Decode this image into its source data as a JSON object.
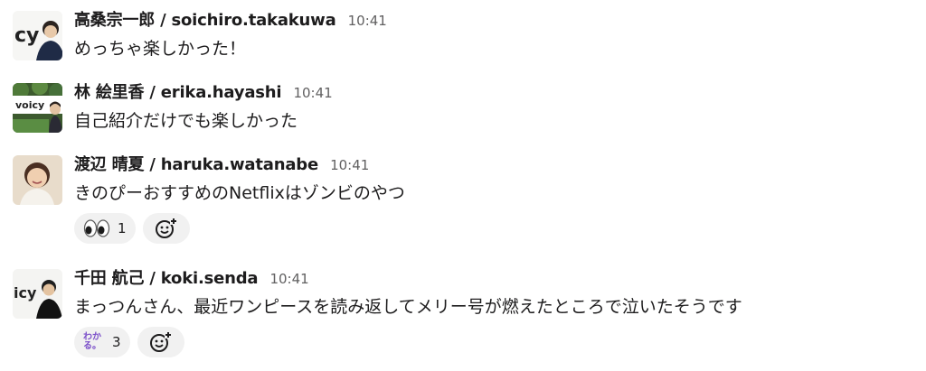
{
  "messages": [
    {
      "author": "高桑宗一郎 / soichiro.takakuwa",
      "time": "10:41",
      "text": "めっちゃ楽しかった！",
      "avatar_text": "cy",
      "reactions": []
    },
    {
      "author": "林 絵里香 / erika.hayashi",
      "time": "10:41",
      "text": "自己紹介だけでも楽しかった",
      "avatar_text": "voicy",
      "reactions": []
    },
    {
      "author": "渡辺 晴夏 / haruka.watanabe",
      "time": "10:41",
      "text": "きのぴーおすすめのNetflixはゾンビのやつ",
      "avatar_text": "",
      "reactions": [
        {
          "emoji": "eyes",
          "count": "1"
        }
      ]
    },
    {
      "author": "千田 航己 / koki.senda",
      "time": "10:41",
      "text": "まっつんさん、最近ワンピースを読み返してメリー号が燃えたところで泣いたそうです",
      "avatar_text": "icy",
      "reactions": [
        {
          "emoji": "wakaru",
          "label": "わか\nる。",
          "count": "3"
        }
      ]
    }
  ],
  "icons": {
    "add_reaction": "add-reaction-icon",
    "eyes": "eyes-emoji",
    "wakaru": "wakaru-emoji"
  },
  "colors": {
    "text": "#1d1c1d",
    "timestamp": "#616061",
    "reaction_bg": "#f1f1f1",
    "wakaru_purple": "#7b4fc9"
  }
}
